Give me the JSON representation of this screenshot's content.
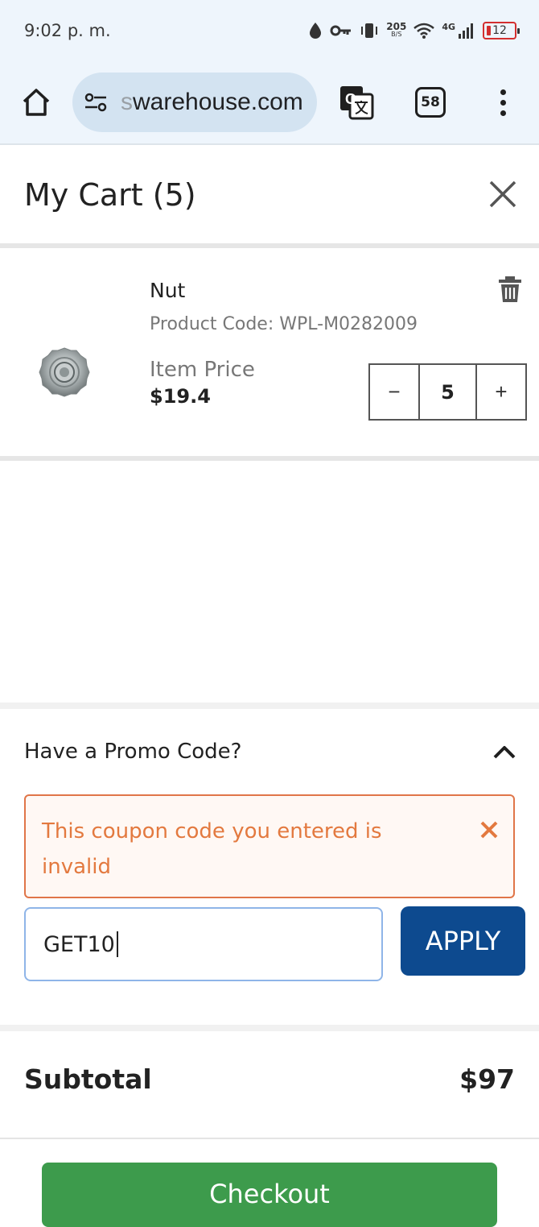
{
  "status_bar": {
    "time": "9:02 p. m.",
    "speed_value": "205",
    "speed_unit": "B/S",
    "network": "4G",
    "battery": "12"
  },
  "browser": {
    "url_fade": "s",
    "url": "warehouse.com",
    "tab_count": "58"
  },
  "cart": {
    "title": "My Cart (5)",
    "item": {
      "name": "Nut",
      "product_code": "Product Code: WPL-M0282009",
      "price_label": "Item Price",
      "price": "$19.4",
      "quantity": "5",
      "minus_label": "−",
      "plus_label": "+"
    }
  },
  "promo": {
    "title": "Have a Promo Code?",
    "error_message": "This coupon code you entered is invalid",
    "input_value": "GET10",
    "apply_label": "APPLY"
  },
  "summary": {
    "subtotal_label": "Subtotal",
    "subtotal_value": "$97",
    "checkout_label": "Checkout"
  },
  "colors": {
    "accent_blue": "#0d4a8f",
    "checkout_green": "#3d9b4c",
    "error_orange": "#e3793f"
  }
}
